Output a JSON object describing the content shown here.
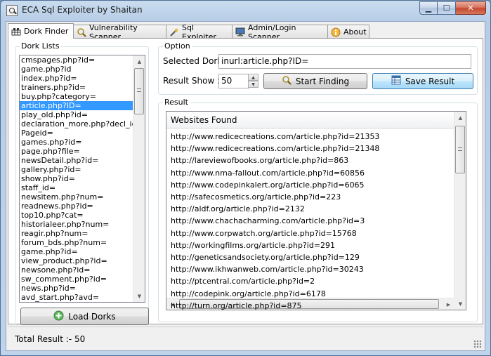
{
  "window": {
    "title": "ECA Sql Exploiter by Shaitan",
    "min_glyph": "▁",
    "max_glyph": "☐",
    "close_glyph": "✕"
  },
  "tabs": [
    {
      "label": "Dork Finder",
      "icon": "grid-icon",
      "active": true
    },
    {
      "label": "Vulnerability Scanner",
      "icon": "magnifier-icon",
      "active": false
    },
    {
      "label": "Sql Exploiter",
      "icon": "wand-icon",
      "active": false
    },
    {
      "label": "Admin/Login Scanner",
      "icon": "monitor-icon",
      "active": false
    },
    {
      "label": "About",
      "icon": "info-icon",
      "active": false
    }
  ],
  "dork_lists": {
    "title": "Dork Lists",
    "items": [
      "cmspages.php?id=",
      "game.php?id",
      "index.php?id=",
      "trainers.php?id=",
      "buy.php?category=",
      "article.php?ID=",
      "play_old.php?id=",
      "declaration_more.php?decl_id=",
      "Pageid=",
      "games.php?id=",
      "page.php?file=",
      "newsDetail.php?id=",
      "gallery.php?id=",
      "show.php?id=",
      "staff_id=",
      "newsitem.php?num=",
      "readnews.php?id=",
      "top10.php?cat=",
      "historialeer.php?num=",
      "reagir.php?num=",
      "forum_bds.php?num=",
      "game.php?id=",
      "view_product.php?id=",
      "newsone.php?id=",
      "sw_comment.php?id=",
      "news.php?id=",
      "avd_start.php?avd="
    ],
    "selected_index": 5,
    "load_button": "Load Dorks"
  },
  "option": {
    "title": "Option",
    "selected_dork_label": "Selected Dork",
    "selected_dork_value": "inurl:article.php?ID=",
    "result_show_label": "Result Show :-",
    "result_show_value": "50",
    "start_button": "Start Finding",
    "save_button": "Save Result"
  },
  "result": {
    "title": "Result",
    "column_header": "Websites Found",
    "items": [
      "http://www.redicecreations.com/article.php?id=21353",
      "http://www.redicecreations.com/article.php?id=21348",
      "http://lareviewofbooks.org/article.php?id=863",
      "http://www.nma-fallout.com/article.php?id=60856",
      "http://www.codepinkalert.org/article.php?id=6065",
      "http://safecosmetics.org/article.php?id=223",
      "http://aldf.org/article.php?id=2132",
      "http://www.chachacharming.com/article.php?id=3",
      "http://www.corpwatch.org/article.php?id=15768",
      "http://workingfilms.org/article.php?id=291",
      "http://geneticsandsociety.org/article.php?id=129",
      "http://www.ikhwanweb.com/article.php?id=30243",
      "http://ptcentral.com/article.php?id=2",
      "http://codepink.org/article.php?id=6178",
      "http://turn.org/article.php?id=875"
    ]
  },
  "status": {
    "total_label": "Total Result :-",
    "total_value": "50"
  },
  "colors": {
    "selection": "#3399ff",
    "titlebar": "#b7cde6"
  }
}
